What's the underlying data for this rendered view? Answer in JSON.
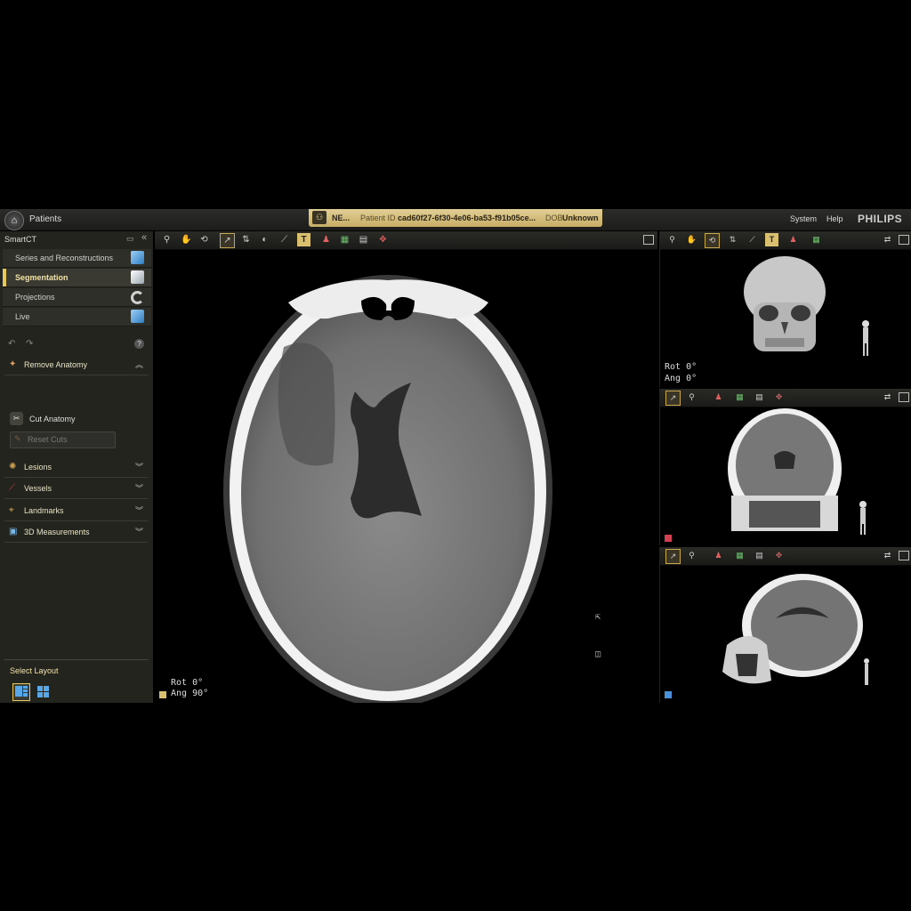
{
  "topbar": {
    "home_icon": "home-icon",
    "patients_label": "Patients",
    "patient_name": "NE...",
    "patient_id_label": "Patient ID",
    "patient_id": "cad60f27-6f30-4e06-ba53-f91b05ce...",
    "dob_label": "DOB",
    "dob": "Unknown",
    "system_label": "System",
    "help_label": "Help",
    "logo": "PHILIPS"
  },
  "left_panel": {
    "title": "SmartCT",
    "nav": [
      {
        "label": "Series and Reconstructions",
        "icon": "cube-icon",
        "active": false
      },
      {
        "label": "Segmentation",
        "icon": "cube-icon",
        "active": true
      },
      {
        "label": "Projections",
        "icon": "rotate-icon",
        "active": false
      },
      {
        "label": "Live",
        "icon": "cube-icon",
        "active": false
      }
    ],
    "remove_anatomy": "Remove Anatomy",
    "cut_anatomy": "Cut Anatomy",
    "reset_cuts": "Reset Cuts",
    "sections": [
      "Lesions",
      "Vessels",
      "Landmarks",
      "3D Measurements"
    ],
    "select_layout": "Select Layout"
  },
  "main_view": {
    "rot": "Rot  0°",
    "ang": "Ang  90°",
    "orient_color": "#d8c070"
  },
  "view_3d": {
    "rot": "Rot  0°",
    "ang": "Ang  0°"
  },
  "colors": {
    "accent": "#e6c860",
    "coronal_marker": "#d04050",
    "sagittal_marker": "#4a90d8"
  }
}
